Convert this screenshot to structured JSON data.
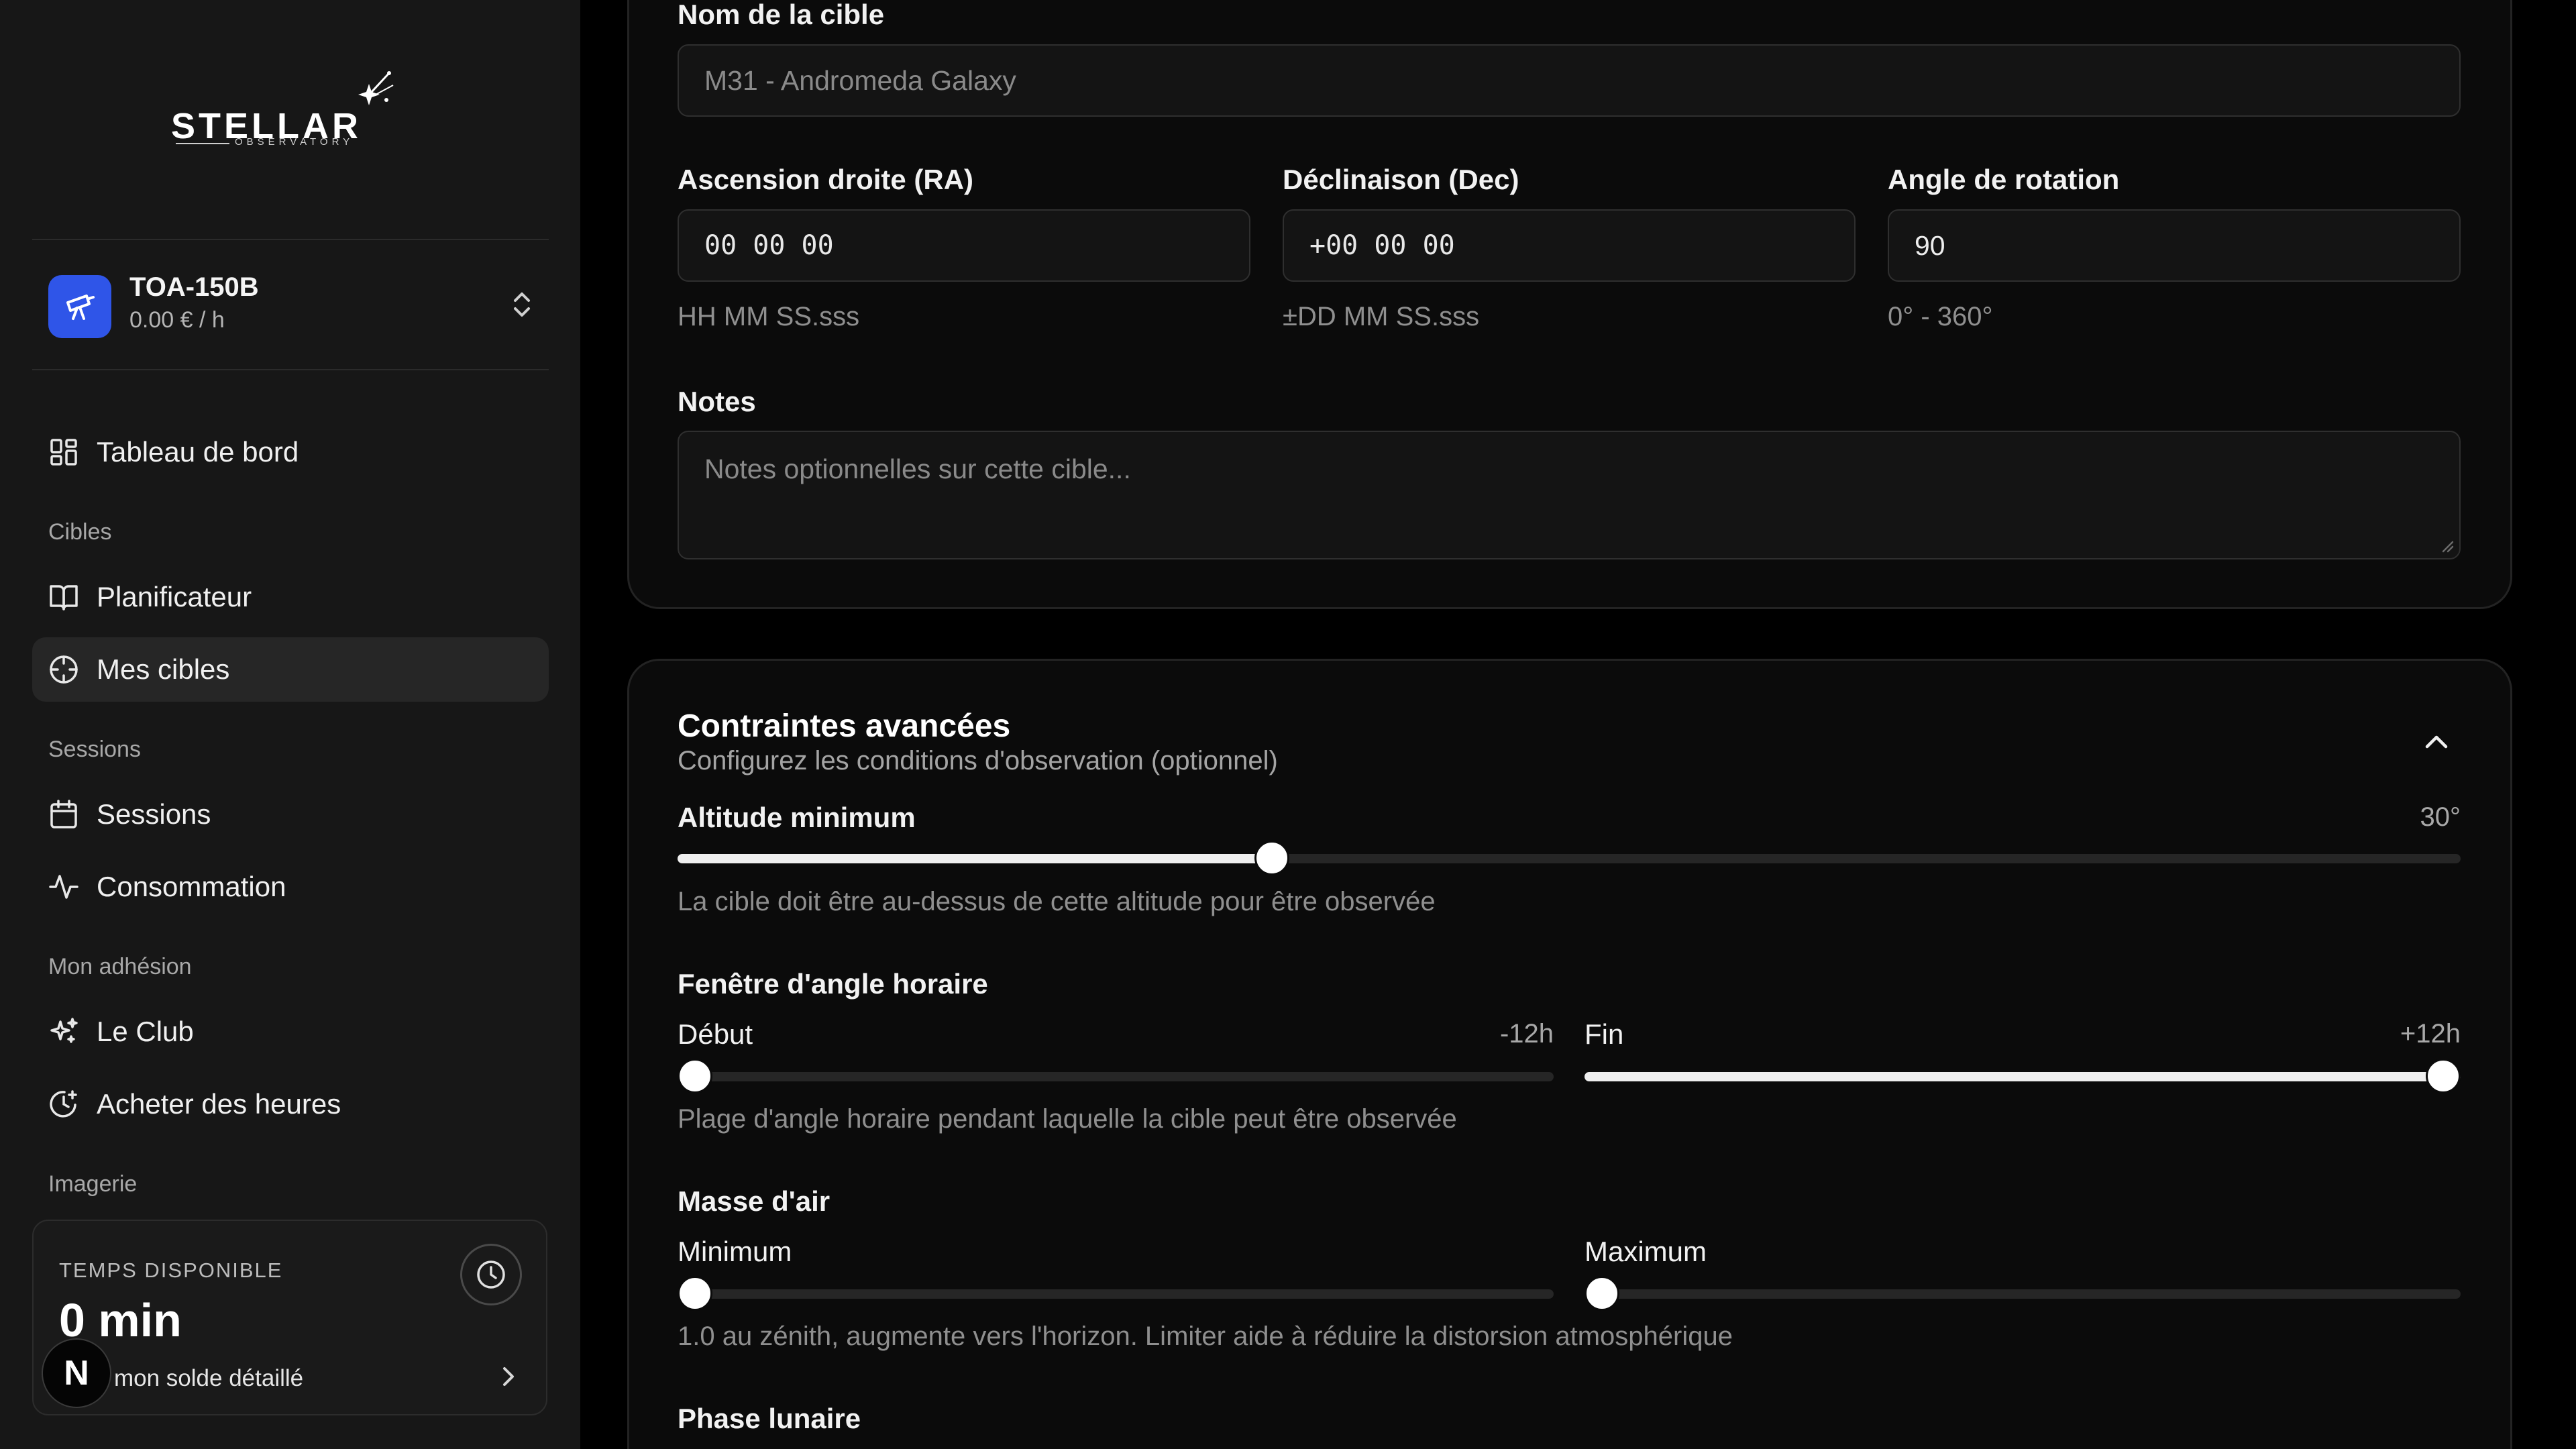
{
  "brand": {
    "name": "STELLAR",
    "subtitle": "OBSERVATORY"
  },
  "telescope": {
    "name": "TOA-150B",
    "price": "0.00 € / h"
  },
  "nav": {
    "dashboard": "Tableau de bord",
    "section_targets": "Cibles",
    "planner": "Planificateur",
    "my_targets": "Mes cibles",
    "section_sessions": "Sessions",
    "sessions": "Sessions",
    "consumption": "Consommation",
    "section_membership": "Mon adhésion",
    "club": "Le Club",
    "buy_hours": "Acheter des heures",
    "section_imaging": "Imagerie"
  },
  "time_card": {
    "label": "TEMPS DISPONIBLE",
    "value": "0 min",
    "link": "mon solde détaillé",
    "avatar_letter": "N"
  },
  "form": {
    "name_label": "Nom de la cible",
    "name_placeholder": "M31 - Andromeda Galaxy",
    "ra_label": "Ascension droite (RA)",
    "ra_value": "00 00 00",
    "ra_hint": "HH MM SS.sss",
    "dec_label": "Déclinaison (Dec)",
    "dec_value": "+00 00 00",
    "dec_hint": "±DD MM SS.sss",
    "rot_label": "Angle de rotation",
    "rot_value": "90",
    "rot_hint": "0° - 360°",
    "notes_label": "Notes",
    "notes_placeholder": "Notes optionnelles sur cette cible..."
  },
  "advanced": {
    "title": "Contraintes avancées",
    "subtitle": "Configurez les conditions d'observation (optionnel)",
    "altitude": {
      "label": "Altitude minimum",
      "value": "30°",
      "fraction": 0.3333,
      "hint": "La cible doit être au-dessus de cette altitude pour être observée"
    },
    "hour_angle": {
      "label": "Fenêtre d'angle horaire",
      "start_label": "Début",
      "start_value": "-12h",
      "start_fraction": 0.0,
      "end_label": "Fin",
      "end_value": "+12h",
      "end_fraction": 1.0,
      "hint": "Plage d'angle horaire pendant laquelle la cible peut être observée"
    },
    "airmass": {
      "label": "Masse d'air",
      "min_label": "Minimum",
      "min_fraction": 0.0,
      "max_label": "Maximum",
      "max_fraction": 0.0,
      "hint": "1.0 au zénith, augmente vers l'horizon. Limiter aide à réduire la distorsion atmosphérique"
    },
    "moon_phase_label": "Phase lunaire"
  }
}
